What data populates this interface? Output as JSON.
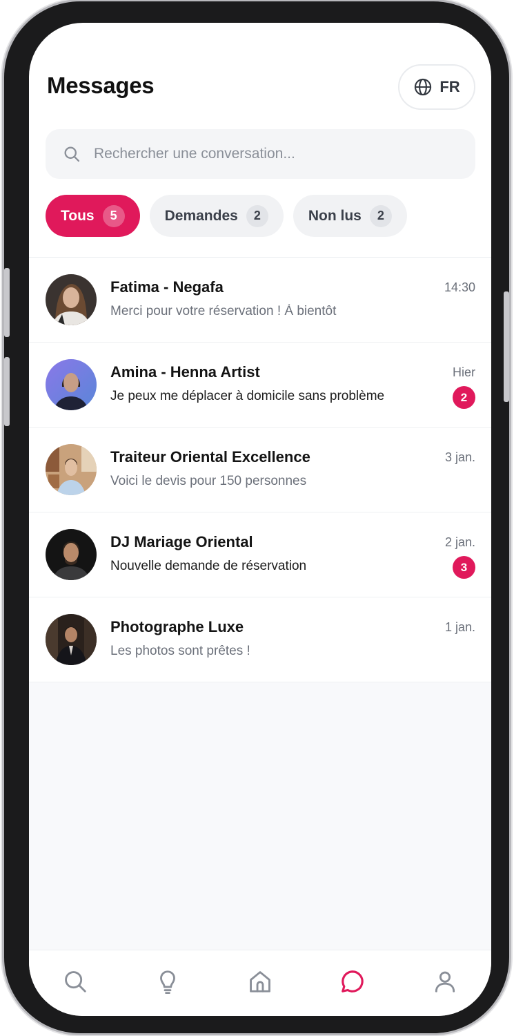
{
  "header": {
    "title": "Messages",
    "language": "FR"
  },
  "search": {
    "placeholder": "Rechercher une conversation..."
  },
  "filters": [
    {
      "label": "Tous",
      "count": "5",
      "active": true
    },
    {
      "label": "Demandes",
      "count": "2",
      "active": false
    },
    {
      "label": "Non lus",
      "count": "2",
      "active": false
    }
  ],
  "conversations": [
    {
      "name": "Fatima - Negafa",
      "preview": "Merci pour votre réservation ! À bientôt",
      "time": "14:30",
      "unread": ""
    },
    {
      "name": "Amina - Henna Artist",
      "preview": "Je peux me déplacer à domicile sans problème",
      "time": "Hier",
      "unread": "2"
    },
    {
      "name": "Traiteur Oriental Excellence",
      "preview": "Voici le devis pour 150 personnes",
      "time": "3 jan.",
      "unread": ""
    },
    {
      "name": "DJ Mariage Oriental",
      "preview": "Nouvelle demande de réservation",
      "time": "2 jan.",
      "unread": "3"
    },
    {
      "name": "Photographe Luxe",
      "preview": "Les photos sont prêtes !",
      "time": "1 jan.",
      "unread": ""
    }
  ],
  "nav": [
    {
      "icon": "search-icon",
      "active": false
    },
    {
      "icon": "lightbulb-icon",
      "active": false
    },
    {
      "icon": "home-icon",
      "active": false
    },
    {
      "icon": "chat-icon",
      "active": true
    },
    {
      "icon": "profile-icon",
      "active": false
    }
  ],
  "colors": {
    "accent": "#e0195b",
    "text": "#141414",
    "muted": "#6b707a",
    "chip_bg": "#f1f2f4",
    "inactive_icon": "#8a8f98"
  }
}
